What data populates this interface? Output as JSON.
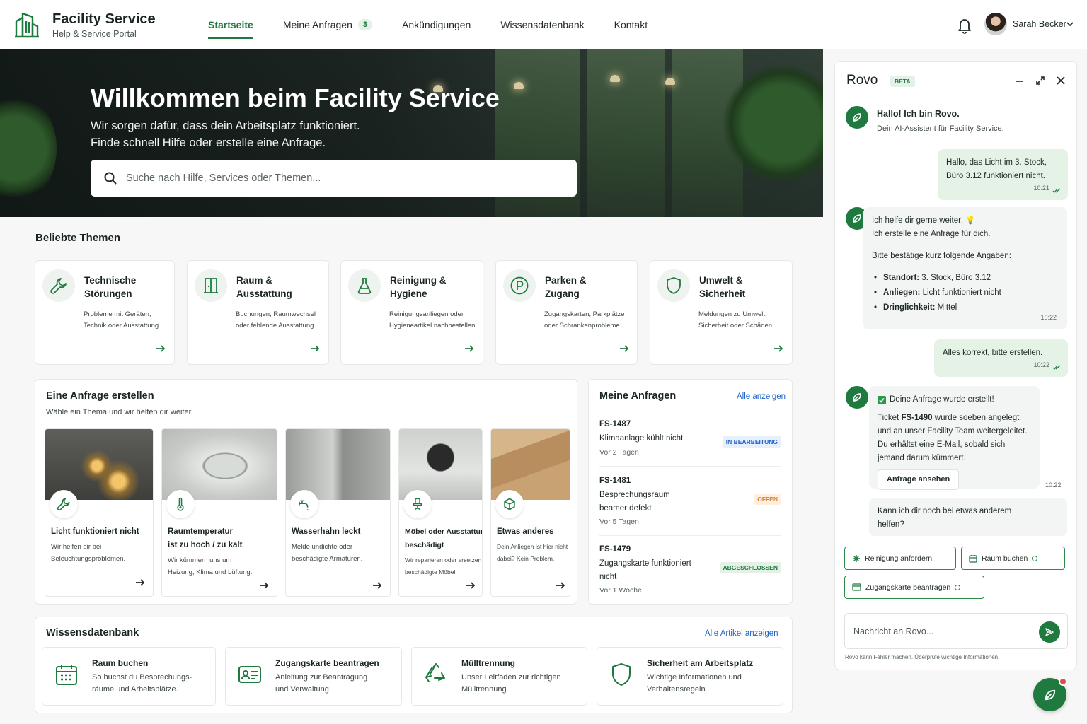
{
  "header": {
    "brand_title": "Facility Service",
    "brand_subtitle": "Help & Service Portal",
    "nav": [
      {
        "label": "Startseite",
        "active": true
      },
      {
        "label": "Meine Anfragen",
        "badge": "3"
      },
      {
        "label": "Ankündigungen"
      },
      {
        "label": "Wissensdatenbank"
      },
      {
        "label": "Kontakt"
      }
    ],
    "user_name": "Sarah Becker"
  },
  "hero": {
    "title": "Willkommen beim Facility Service",
    "subtitle_line1": "Wir sorgen dafür, dass dein Arbeitsplatz funktioniert.",
    "subtitle_line2": "Finde schnell Hilfe oder erstelle eine Anfrage.",
    "search_placeholder": "Suche nach Hilfe, Services oder Themen..."
  },
  "topics": {
    "title": "Beliebte Themen",
    "items": [
      {
        "title_1": "Technische",
        "title_2": "Störungen",
        "desc_1": "Probleme mit Geräten,",
        "desc_2": "Technik oder Ausstattung",
        "icon": "wrench-icon"
      },
      {
        "title_1": "Raum &",
        "title_2": "Ausstattung",
        "desc_1": "Buchungen, Raumwechsel",
        "desc_2": "oder fehlende Ausstattung",
        "icon": "door-icon"
      },
      {
        "title_1": "Reinigung &",
        "title_2": "Hygiene",
        "desc_1": "Reinigungsanliegen oder",
        "desc_2": "Hygieneartikel nachbestellen",
        "icon": "cleaning-icon"
      },
      {
        "title_1": "Parken &",
        "title_2": "Zugang",
        "desc_1": "Zugangskarten, Parkplätze",
        "desc_2": "oder Schrankenprobleme",
        "icon": "parking-icon"
      },
      {
        "title_1": "Umwelt &",
        "title_2": "Sicherheit",
        "desc_1": "Meldungen zu Umwelt,",
        "desc_2": "Sicherheit oder Schäden",
        "icon": "shield-icon"
      }
    ]
  },
  "create_request": {
    "title": "Eine Anfrage erstellen",
    "subtitle": "Wähle ein Thema und wir helfen dir weiter.",
    "items": [
      {
        "title_1": "Licht funktioniert nicht",
        "title_2": "",
        "desc_1": "Wir helfen dir bei",
        "desc_2": "Beleuchtungsproblemen.",
        "icon": "wrench-icon"
      },
      {
        "title_1": "Raumtemperatur",
        "title_2": "ist zu hoch / zu kalt",
        "desc_1": "Wir kümmern uns um",
        "desc_2": "Heizung, Klima und Lüftung.",
        "icon": "thermometer-icon"
      },
      {
        "title_1": "Wasserhahn leckt",
        "title_2": "",
        "desc_1": "Melde undichte oder",
        "desc_2": "beschädigte Armaturen.",
        "icon": "faucet-icon"
      },
      {
        "title_1": "Möbel oder Ausstattung",
        "title_2": "beschädigt",
        "desc_1": "Wir reparieren oder ersetzen",
        "desc_2": "beschädigte Möbel.",
        "icon": "chair-icon"
      },
      {
        "title_1": "Etwas anderes",
        "title_2": "",
        "desc_1": "Dein Anliegen ist hier nicht",
        "desc_2": "dabei? Kein Problem.",
        "icon": "box-icon"
      }
    ]
  },
  "my_requests": {
    "title": "Meine Anfragen",
    "view_all": "Alle anzeigen",
    "items": [
      {
        "id": "FS-1487",
        "title_1": "Klimaanlage kühlt nicht",
        "title_2": "",
        "date": "Vor 2 Tagen",
        "status": "IN BEARBEITUNG",
        "status_color": "#1e63c7",
        "status_bg": "#e6effb"
      },
      {
        "id": "FS-1481",
        "title_1": "Besprechungsraum",
        "title_2": "beamer defekt",
        "date": "Vor 5 Tagen",
        "status": "OFFEN",
        "status_color": "#d9822b",
        "status_bg": "#fdf0e2"
      },
      {
        "id": "FS-1479",
        "title_1": "Zugangskarte funktioniert",
        "title_2": "nicht",
        "date": "Vor 1 Woche",
        "status": "ABGESCHLOSSEN",
        "status_color": "#1e7a3e",
        "status_bg": "#e3f1e6"
      }
    ]
  },
  "knowledge": {
    "title": "Wissensdatenbank",
    "view_all": "Alle Artikel anzeigen",
    "items": [
      {
        "title": "Raum buchen",
        "desc_1": "So buchst du Besprechungs-",
        "desc_2": "räume und Arbeitsplätze.",
        "icon": "calendar-icon"
      },
      {
        "title": "Zugangskarte beantragen",
        "desc_1": "Anleitung zur Beantragung",
        "desc_2": "und Verwaltung.",
        "icon": "id-card-icon"
      },
      {
        "title": "Mülltrennung",
        "desc_1": "Unser Leitfaden zur richtigen",
        "desc_2": "Mülltrennung.",
        "icon": "recycle-icon"
      },
      {
        "title": "Sicherheit am Arbeitsplatz",
        "desc_1": "Wichtige Informationen und",
        "desc_2": "Verhaltensregeln.",
        "icon": "shield-icon"
      }
    ]
  },
  "rovo": {
    "title": "Rovo",
    "badge": "BETA",
    "greeting_title": "Hallo! Ich bin Rovo.",
    "greeting_sub": "Dein AI-Assistent für Facility Service.",
    "msg1_line1": "Hallo, das Licht im 3. Stock,",
    "msg1_line2": "Büro 3.12 funktioniert nicht.",
    "msg1_time": "10:21",
    "msg2_line1": "Ich helfe dir gerne weiter! 💡",
    "msg2_line2": "Ich erstelle eine Anfrage für dich.",
    "msg2_line3": "Bitte bestätige kurz folgende Angaben:",
    "msg2_bullets": [
      {
        "label": "Standort:",
        "value": " 3. Stock, Büro 3.12"
      },
      {
        "label": "Anliegen:",
        "value": " Licht funktioniert nicht"
      },
      {
        "label": "Dringlichkeit:",
        "value": " Mittel"
      }
    ],
    "msg2_time": "10:22",
    "msg3": "Alles korrekt, bitte erstellen.",
    "msg3_time": "10:22",
    "msg4_title": "Deine Anfrage wurde erstellt!",
    "msg4_pre": "Ticket ",
    "msg4_ticket": "FS-1490",
    "msg4_post": " wurde soeben angelegt",
    "msg4_line2": "und an unser Facility Team weitergeleitet.",
    "msg4_line3": "Du erhältst eine E-Mail, sobald sich",
    "msg4_line4": "jemand darum kümmert.",
    "msg4_button": "Anfrage ansehen",
    "msg4_time": "10:22",
    "msg5_line1": "Kann ich dir noch bei etwas anderem",
    "msg5_line2": "helfen?",
    "chips": [
      "Reinigung anfordern",
      "Raum buchen",
      "Zugangskarte beantragen"
    ],
    "input_placeholder": "Nachricht an Rovo...",
    "disclaimer": "Rovo kann Fehler machen. Überprüfe wichtige Informationen."
  },
  "colors": {
    "accent": "#1e7a3e",
    "link": "#1e63c7"
  }
}
